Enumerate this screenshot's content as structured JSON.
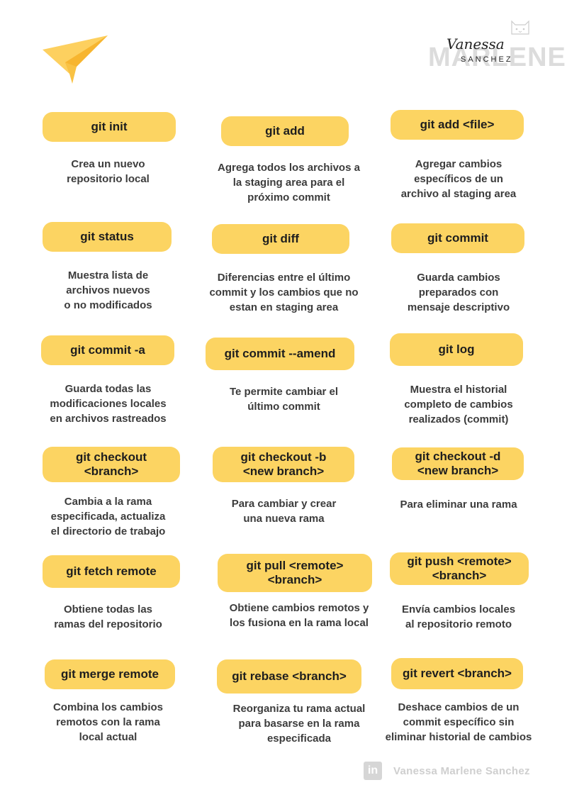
{
  "logo": {
    "bigword": "MARLENE",
    "script": "Vanessa",
    "small": "SANCHEZ"
  },
  "commands": [
    {
      "cmd": "git init",
      "desc": "Crea un nuevo\nrepositorio local"
    },
    {
      "cmd": "git add",
      "desc": "Agrega todos los archivos a\nla staging area para el\npróximo commit"
    },
    {
      "cmd": "git add <file>",
      "desc": "Agregar cambios\nespecíficos de un\narchivo al staging area"
    },
    {
      "cmd": "git status",
      "desc": "Muestra lista de\narchivos nuevos\no no modificados"
    },
    {
      "cmd": "git diff",
      "desc": "Diferencias entre el último\ncommit y los cambios que no\nestan en staging area"
    },
    {
      "cmd": "git commit",
      "desc": "Guarda cambios\npreparados con\nmensaje descriptivo"
    },
    {
      "cmd": "git commit -a",
      "desc": "Guarda todas las\nmodificaciones locales\nen archivos rastreados"
    },
    {
      "cmd": "git commit --amend",
      "desc": "Te permite cambiar el\núltimo commit"
    },
    {
      "cmd": "git log",
      "desc": "Muestra el historial\ncompleto de cambios\nrealizados (commit)"
    },
    {
      "cmd": "git checkout\n<branch>",
      "desc": "Cambia a la rama\nespecificada, actualiza\nel directorio de trabajo"
    },
    {
      "cmd": "git checkout  -b\n<new branch>",
      "desc": "Para cambiar y  crear\nuna nueva rama"
    },
    {
      "cmd": "git checkout -d\n<new branch>",
      "desc": "Para eliminar una rama"
    },
    {
      "cmd": "git fetch remote",
      "desc": "Obtiene todas las\nramas del repositorio"
    },
    {
      "cmd": "git pull <remote>\n<branch>",
      "desc": "Obtiene cambios remotos y\nlos fusiona en la rama local"
    },
    {
      "cmd": "git push <remote>\n<branch>",
      "desc": "Envía cambios locales\nal repositorio remoto"
    },
    {
      "cmd": "git merge remote",
      "desc": "Combina los cambios\nremotos con la rama\nlocal actual"
    },
    {
      "cmd": "git rebase <branch>",
      "desc": "Reorganiza tu rama actual\npara basarse en la rama\nespecificada"
    },
    {
      "cmd": "git revert <branch>",
      "desc": "Deshace cambios de un\ncommit específico sin\neliminar historial de cambios"
    }
  ],
  "footer": {
    "icon_text": "in",
    "name": "Vanessa Marlene Sanchez"
  },
  "colors": {
    "pill": "#fcd462",
    "plane_light": "#fdd05f",
    "plane_dark": "#f7b52f"
  }
}
